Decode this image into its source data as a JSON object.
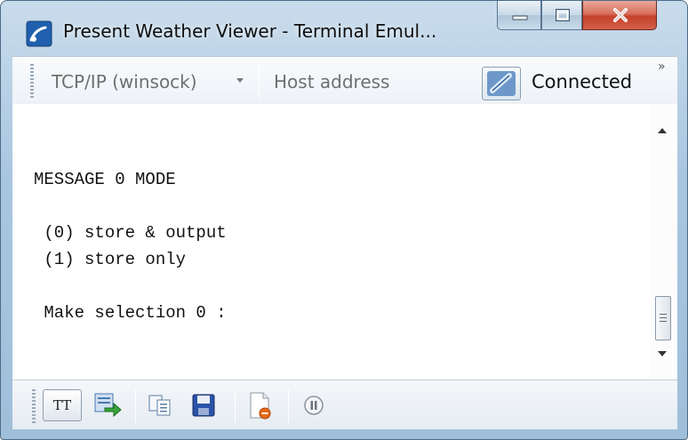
{
  "window": {
    "title": "Present Weather Viewer - Terminal Emul...",
    "caption_buttons": [
      "minimize",
      "maximize",
      "close"
    ]
  },
  "toolbar": {
    "transport": "TCP/IP (winsock)",
    "host_placeholder": "Host address",
    "status": "Connected",
    "overflow_glyph": "»"
  },
  "terminal": {
    "lines": [
      "",
      "MESSAGE 0 MODE",
      "",
      " (0) store & output",
      " (1) store only",
      "",
      " Make selection 0 :"
    ]
  },
  "bottom_toolbar": {
    "tt_label": "TT",
    "buttons": [
      "tt-toggle",
      "send-file",
      "copy",
      "save",
      "new-log",
      "pause"
    ]
  },
  "colors": {
    "accent": "#1e5fa8",
    "close_red": "#c4412a",
    "text": "#111111",
    "muted_text": "#6f6f6f"
  }
}
